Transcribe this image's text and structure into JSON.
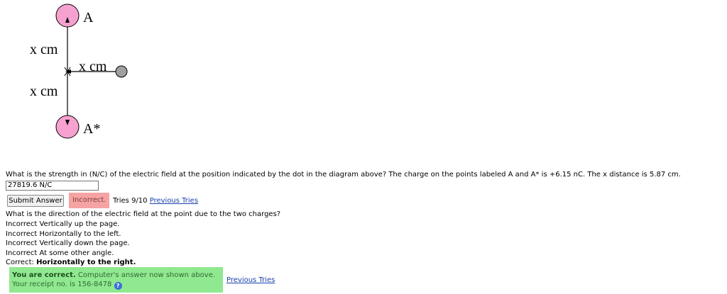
{
  "diagram": {
    "label_top": "A",
    "label_bottom": "A*",
    "label_upper_x": "x cm",
    "label_lower_x": "x cm",
    "label_horizontal_x": "x cm",
    "charge_color": "#f7a1d1",
    "dot_color": "#a0a0a0"
  },
  "question1": {
    "text": "What is the strength in (N/C) of the electric field at the position indicated by the dot in the diagram above? The charge on the points labeled A and A* is +6.15 nC. The x distance is 5.87 cm.",
    "answer_value": "27819.6 N/C",
    "submit_label": "Submit Answer",
    "status": "Incorrect.",
    "tries": "Tries 9/10",
    "previous_tries": "Previous Tries"
  },
  "question2": {
    "text": "What is the direction of the electric field at the point due to the two charges?",
    "options": [
      "Incorrect Vertically up the page.",
      "Incorrect Horizontally to the left.",
      "Incorrect Vertically down the page.",
      "Incorrect At some other angle."
    ],
    "correct_prefix": "Correct:",
    "correct_answer": "Horizontally to the right.",
    "feedback_bold": "You are correct.",
    "feedback_rest": "Computer's answer now shown above.",
    "receipt": "Your receipt no. is 156-8478",
    "help_glyph": "?",
    "previous_tries": "Previous Tries"
  },
  "colors": {
    "incorrect_bg": "#f5a3a3",
    "correct_bg": "#90e890",
    "link": "#1a3faa"
  }
}
